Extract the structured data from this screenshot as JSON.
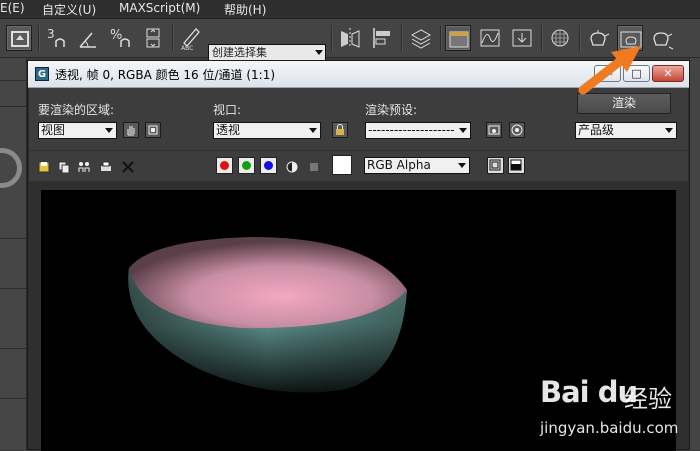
{
  "menubar": {
    "items": [
      "E(E)",
      "自定义(U)",
      "MAXScript(M)",
      "帮助(H)"
    ]
  },
  "toolbar": {
    "selection_set_placeholder": "创建选择集",
    "snap_labels": [
      "3",
      "%"
    ],
    "icons": [
      "undo-icon",
      "snap-3d-icon",
      "angle-snap-icon",
      "percent-snap-icon",
      "spinner-snap-icon",
      "edit-named-selection-icon",
      "mirror-icon",
      "align-icon",
      "layer-manager-icon",
      "scene-explorer-icon",
      "curve-editor-icon",
      "schematic-view-icon",
      "material-editor-icon",
      "render-setup-icon",
      "rendered-frame-window-icon",
      "render-production-icon"
    ]
  },
  "annotation": {
    "arrow_color": "#f07a20"
  },
  "window": {
    "title": "透视, 帧 0, RGBA 颜色 16 位/通道 (1:1)",
    "app_icon": "G",
    "buttons": {
      "minimize": "—",
      "maximize": "□",
      "close": "✕"
    }
  },
  "controls": {
    "area_label": "要渲染的区域:",
    "area_value": "视图",
    "viewport_label": "视口:",
    "viewport_value": "透视",
    "preset_label": "渲染预设:",
    "preset_value": "--------------------",
    "render_button": "渲染",
    "quality_value": "产品级"
  },
  "channels": {
    "red": "#e01010",
    "green": "#10a010",
    "blue": "#1010e0",
    "display_mode": "RGB Alpha"
  },
  "watermark": {
    "logo": "Bai du",
    "chinese": "经验",
    "url": "jingyan.baidu.com"
  }
}
